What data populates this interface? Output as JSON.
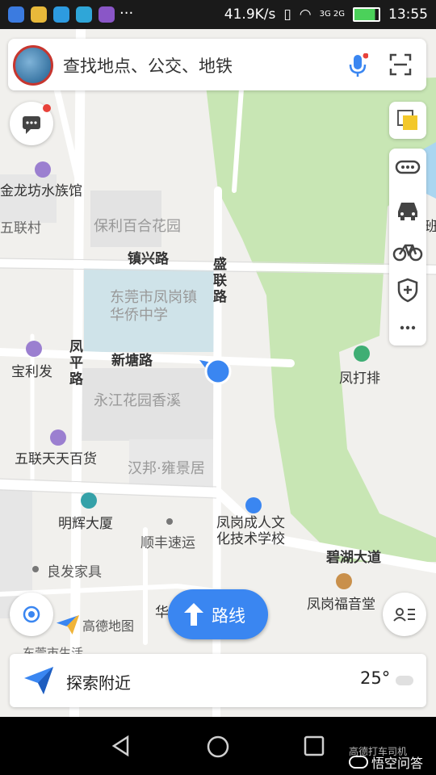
{
  "status_bar": {
    "speed": "41.9K/s",
    "network": "3G 2G",
    "time": "13:55",
    "more": "···"
  },
  "search": {
    "placeholder": "查找地点、公交、地铁"
  },
  "map": {
    "labels": {
      "jinlongfang": "金龙坊水族馆",
      "wulian_village": "五联村",
      "baoli_garden": "保利百合花园",
      "zhenxing_road": "镇兴路",
      "shenglian_road": "盛联路",
      "school": "东莞市凤岗镇华侨中学",
      "xintang_road": "新塘路",
      "fengping_road": "凤平路",
      "baolifa": "宝利发",
      "yongjiang": "永江花园香溪",
      "fengdapai": "凤打排",
      "wulian_store": "五联天天百货",
      "hanbang": "汉邦·雍景居",
      "minghui": "明辉大厦",
      "sf": "顺丰速运",
      "culture_school": "凤岗成人文化技术学校",
      "bihu": "碧湖大道",
      "liangfa": "良发家具",
      "fenggang_church": "凤岗福音堂",
      "gaode_logo": "高德地图",
      "hua": "华",
      "dongguan_partial": "东莞市生活",
      "ban_partial": "班"
    },
    "colors": {
      "green": "#c8e6b4",
      "building": "#e3e3e3",
      "school": "#cfe3e9",
      "road": "#ffffff"
    }
  },
  "buttons": {
    "route": "路线",
    "explore": "探索附近"
  },
  "weather": {
    "temp": "25°"
  },
  "watermark": "悟空问答",
  "watermark_top": "高德打车司机"
}
